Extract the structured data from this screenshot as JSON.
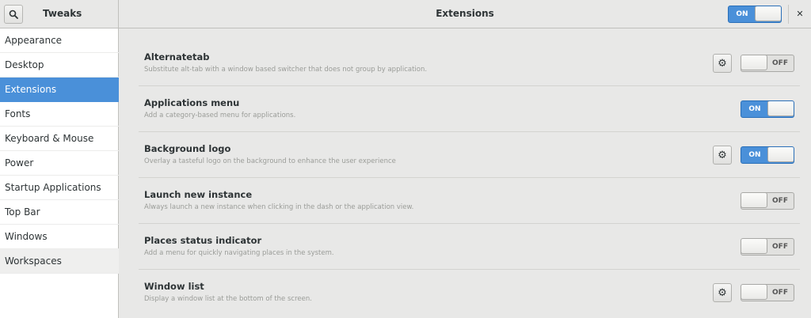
{
  "header": {
    "app_title": "Tweaks",
    "page_title": "Extensions",
    "global_switch": "ON",
    "close_glyph": "✕",
    "search_icon": "search-icon"
  },
  "sidebar": {
    "items": [
      {
        "label": "Appearance",
        "selected": false
      },
      {
        "label": "Desktop",
        "selected": false
      },
      {
        "label": "Extensions",
        "selected": true
      },
      {
        "label": "Fonts",
        "selected": false
      },
      {
        "label": "Keyboard & Mouse",
        "selected": false
      },
      {
        "label": "Power",
        "selected": false
      },
      {
        "label": "Startup Applications",
        "selected": false
      },
      {
        "label": "Top Bar",
        "selected": false
      },
      {
        "label": "Windows",
        "selected": false
      },
      {
        "label": "Workspaces",
        "selected": false
      }
    ]
  },
  "extensions": [
    {
      "title": "Alternatetab",
      "description": "Substitute alt-tab with a window based switcher that does not group by application.",
      "switch": "OFF",
      "has_settings": true
    },
    {
      "title": "Applications menu",
      "description": "Add a category-based menu for applications.",
      "switch": "ON",
      "has_settings": false
    },
    {
      "title": "Background logo",
      "description": "Overlay a tasteful logo on the background to enhance the user experience",
      "switch": "ON",
      "has_settings": true
    },
    {
      "title": "Launch new instance",
      "description": "Always launch a new instance when clicking in the dash or the application view.",
      "switch": "OFF",
      "has_settings": false
    },
    {
      "title": "Places status indicator",
      "description": "Add a menu for quickly navigating places in the system.",
      "switch": "OFF",
      "has_settings": false
    },
    {
      "title": "Window list",
      "description": "Display a window list at the bottom of the screen.",
      "switch": "OFF",
      "has_settings": true
    }
  ],
  "colors": {
    "accent": "#4a90d9",
    "sidebar_bg": "#ffffff",
    "content_bg": "#e8e8e7"
  }
}
